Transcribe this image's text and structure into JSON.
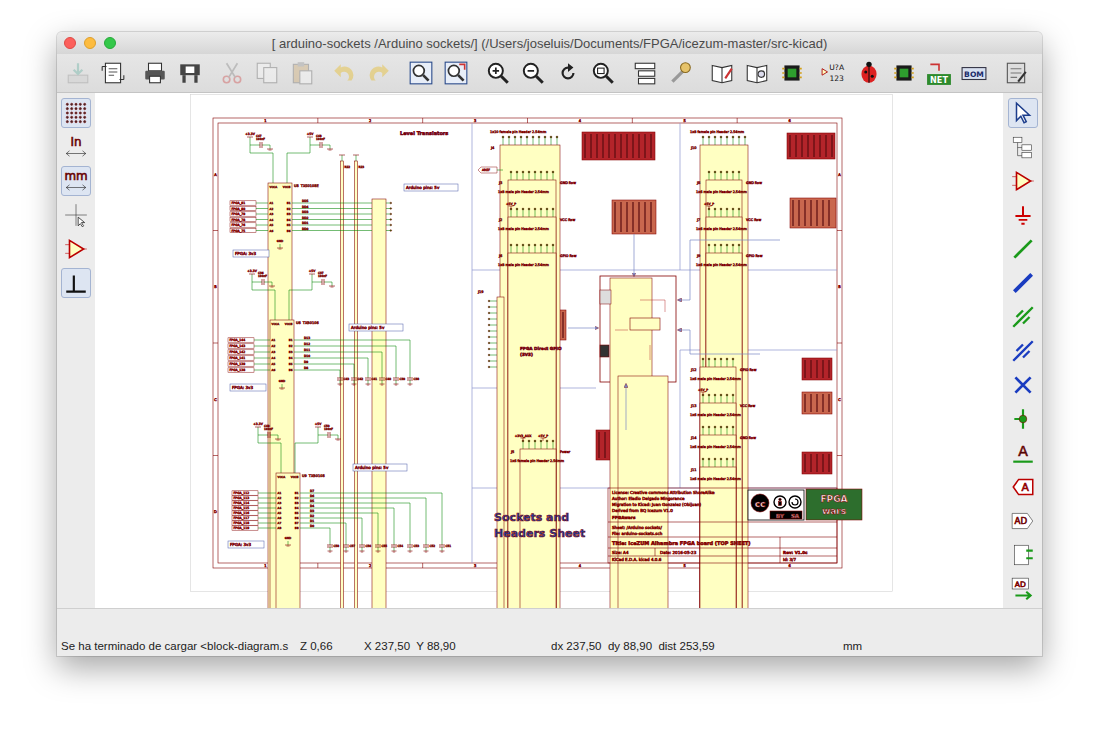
{
  "window": {
    "title": "[ arduino-sockets /Arduino sockets/] (/Users/joseluis/Documents/FPGA/icezum-master/src-kicad)"
  },
  "toolbar": {
    "groups": [
      [
        {
          "kind": "save",
          "disabled": true
        },
        {
          "kind": "page-settings",
          "disabled": false
        }
      ],
      [
        {
          "kind": "print",
          "disabled": false
        },
        {
          "kind": "plot",
          "disabled": false
        }
      ],
      [
        {
          "kind": "cut",
          "disabled": true
        },
        {
          "kind": "copy",
          "disabled": true
        },
        {
          "kind": "paste",
          "disabled": true
        }
      ],
      [
        {
          "kind": "undo",
          "disabled": true
        },
        {
          "kind": "redo",
          "disabled": true
        }
      ],
      [
        {
          "kind": "find",
          "disabled": false
        },
        {
          "kind": "find-replace",
          "disabled": false
        }
      ],
      [
        {
          "kind": "zoom-in",
          "disabled": false
        },
        {
          "kind": "zoom-out",
          "disabled": false
        },
        {
          "kind": "redraw",
          "disabled": false
        },
        {
          "kind": "zoom-fit",
          "disabled": false
        }
      ],
      [
        {
          "kind": "hierarchy",
          "disabled": false
        },
        {
          "kind": "leave-sheet",
          "disabled": false
        }
      ],
      [
        {
          "kind": "lib-editor",
          "disabled": false
        },
        {
          "kind": "lib-browser",
          "disabled": false
        },
        {
          "kind": "footprint",
          "disabled": false
        }
      ],
      [
        {
          "kind": "annotate",
          "label": "U?A",
          "sublabel": "123",
          "disabled": false
        },
        {
          "kind": "erc",
          "disabled": false
        },
        {
          "kind": "assign-fp",
          "disabled": false
        },
        {
          "kind": "netlist",
          "label": "NET",
          "disabled": false
        },
        {
          "kind": "bom",
          "label": "BOM",
          "disabled": false
        }
      ],
      [
        {
          "kind": "pcbnew",
          "disabled": false
        }
      ]
    ]
  },
  "left_toolbar": [
    {
      "kind": "grid",
      "selected": true
    },
    {
      "kind": "units-inch",
      "label": "In",
      "selected": false
    },
    {
      "kind": "units-mm",
      "label": "mm",
      "selected": true
    },
    {
      "kind": "cursor",
      "selected": false
    },
    {
      "kind": "hidden-pins",
      "selected": false
    },
    {
      "kind": "wire-angle",
      "selected": true
    }
  ],
  "right_toolbar": [
    {
      "kind": "select",
      "selected": true
    },
    {
      "kind": "hier-nav",
      "selected": false
    },
    {
      "kind": "component",
      "selected": false
    },
    {
      "kind": "power",
      "selected": false
    },
    {
      "kind": "wire",
      "selected": false
    },
    {
      "kind": "bus",
      "selected": false
    },
    {
      "kind": "wire-entry",
      "selected": false
    },
    {
      "kind": "bus-entry",
      "selected": false
    },
    {
      "kind": "no-connect",
      "selected": false
    },
    {
      "kind": "junction",
      "selected": false
    },
    {
      "kind": "net-label",
      "label": "A",
      "selected": false
    },
    {
      "kind": "global-label",
      "label": "A",
      "selected": false
    },
    {
      "kind": "hier-label",
      "label": "AD",
      "selected": false
    },
    {
      "kind": "hier-sheet",
      "selected": false
    },
    {
      "kind": "import-pin",
      "label": "AD",
      "selected": false
    }
  ],
  "schematic": {
    "frame": {
      "columns": [
        "1",
        "2",
        "3",
        "4",
        "5",
        "6"
      ],
      "rows": [
        "A",
        "B",
        "C",
        "D"
      ]
    },
    "section_title": "Level Translators",
    "translators": [
      {
        "ref": "U8",
        "part": "TXS0108E",
        "fpga_pins": [
          "FPGA_81",
          "FPGA_80",
          "FPGA_79",
          "FPGA_78",
          "FPGA_76",
          "FPGA_75"
        ],
        "a_pins": [
          "A1",
          "A2",
          "A3",
          "A4",
          "A5",
          "A6"
        ],
        "b_pins": [
          "B1",
          "B2",
          "B3",
          "B4",
          "B5",
          "B6"
        ],
        "nets": [
          "DD5",
          "DD4",
          "DD3",
          "DD2",
          "DD1",
          "DD0"
        ],
        "supply_pins": [
          "VCCA",
          "VCCB"
        ],
        "ground_pin": "GND",
        "caps": [
          {
            "ref": "C47",
            "value": "100nF"
          },
          {
            "ref": "C48",
            "value": "100nF"
          }
        ],
        "power": [
          "+3.3V",
          "+5V"
        ],
        "pullups": [
          "R22",
          "R23"
        ],
        "load_caps": [],
        "arduino_label": "Arduino pins: 5v",
        "fpga_label": "FPGA: 3v3"
      },
      {
        "ref": "U6",
        "part": "TXB0106",
        "fpga_pins": [
          "FPGA_144",
          "FPGA_143",
          "FPGA_142",
          "FPGA_141",
          "FPGA_139",
          "FPGA_138"
        ],
        "a_pins": [
          "A1",
          "A2",
          "A3",
          "A4",
          "A5",
          "A6"
        ],
        "b_pins": [
          "B1",
          "B2",
          "B3",
          "B4",
          "B5",
          "B6"
        ],
        "nets": [
          "D13",
          "D12",
          "D11",
          "D10",
          "D9",
          "D8"
        ],
        "supply_pins": [
          "VCCA",
          "VCCB"
        ],
        "ground_pin": "GND",
        "caps": [
          {
            "ref": "C36",
            "value": "100nF"
          },
          {
            "ref": "C37",
            "value": "100nF"
          }
        ],
        "power": [
          "+3.3V",
          "+5V"
        ],
        "pullups": [],
        "load_caps": [
          "C38",
          "C39",
          "C40",
          "C41",
          "C42",
          "C43"
        ],
        "arduino_label": "Arduino pins: 5v",
        "fpga_label": "FPGA: 3v3"
      },
      {
        "ref": "U9",
        "part": "TXB0108",
        "fpga_pins": [
          "FPGA_112",
          "FPGA_113",
          "FPGA_114",
          "FPGA_115",
          "FPGA_116",
          "FPGA_117",
          "FPGA_118",
          "FPGA_119"
        ],
        "a_pins": [
          "A1",
          "A2",
          "A3",
          "A4",
          "A5",
          "A6",
          "A7",
          "A8"
        ],
        "b_pins": [
          "B1",
          "B2",
          "B3",
          "B4",
          "B5",
          "B6",
          "B7",
          "B8"
        ],
        "nets": [
          "D7",
          "D6",
          "D5",
          "D4",
          "D3",
          "D2",
          "D1",
          "D0"
        ],
        "supply_pins": [
          "VCCA",
          "VCCB"
        ],
        "ground_pin": "GND",
        "caps": [
          {
            "ref": "C49",
            "value": "100nF"
          },
          {
            "ref": "C50",
            "value": "100nF"
          }
        ],
        "power": [
          "+3.3V",
          "+5V"
        ],
        "pullups": [],
        "load_caps": [
          "C51",
          "C52",
          "C53",
          "C54",
          "C55",
          "C56",
          "C57",
          "C58"
        ],
        "arduino_label": "Arduino pins: 5v",
        "fpga_label": "FPGA: 3v3"
      }
    ],
    "headers": [
      {
        "ref": "J4",
        "caption": "1x10 female pin Header 2.54mm",
        "row": "",
        "power": []
      },
      {
        "ref": "J3",
        "caption": "1x8 male pin Header 2.54mm",
        "row": "GND Row",
        "power": []
      },
      {
        "ref": "J2",
        "caption": "1x8 male pin Header 2.54mm",
        "row": "VCC Row",
        "power": [
          "+5V_P"
        ]
      },
      {
        "ref": "J6",
        "caption": "1x8 male pin Header 2.54mm",
        "row": "GPIO Row",
        "power": []
      },
      {
        "ref": "J10",
        "caption": "1x8 female pin Header 2.54mm",
        "row": "",
        "power": []
      },
      {
        "ref": "J8",
        "caption": "1x6 male pin Header 2.54mm",
        "row": "GND Row",
        "power": []
      },
      {
        "ref": "J7",
        "caption": "1x6 male pin Header 2.54mm",
        "row": "VCC Row",
        "power": [
          "+5V_P"
        ]
      },
      {
        "ref": "J9",
        "caption": "1x6 male pin Header 2.54mm",
        "row": "GPIO Row",
        "power": []
      },
      {
        "ref": "J12",
        "caption": "1x6 male pin Header 2.54mm",
        "row": "GPIO Row",
        "power": []
      },
      {
        "ref": "J13",
        "caption": "1x6 male pin Header 2.54mm",
        "row": "VCC Row",
        "power": [
          "+5V_P"
        ]
      },
      {
        "ref": "J14",
        "caption": "1x6 male pin Header 2.54mm",
        "row": "GND Row",
        "power": []
      },
      {
        "ref": "J11",
        "caption": "1x6 male pin Header 2.54mm",
        "row": "",
        "power": []
      },
      {
        "ref": "J5",
        "caption": "1x6 female pin Header 2.54mm",
        "row": "Power",
        "power": [
          "+3V3_AUX",
          "+5V_P"
        ]
      }
    ],
    "aref": "AREF",
    "gpio": {
      "ref": "J19",
      "caption": [
        "FPGA Direct GPIO",
        "(3V3)"
      ]
    },
    "sheet_title": [
      "Sockets and",
      "Headers Sheet"
    ],
    "title_block": {
      "notes": [
        "License: Creative commons Attribution ShareAlike",
        "Author: Eladio Delgado Mingorance",
        "Migration to Kicad: Juan Gonzalez (Obijuan)",
        "Derived from BQ Icezum V1.0"
      ],
      "company": "FPGAwars",
      "sheet": "Sheet: /Arduino sockets/",
      "file": "File: arduino-sockets.sch",
      "title": "Title: IceZUM Alhambra FPGA board (TOP SHEET)",
      "size": "Size: A4",
      "date": "Date: 2016-05-23",
      "rev": "Rev: V1.0c",
      "tool": "KiCad E.D.A.  kicad 4.0.6",
      "id": "Id: 3/7"
    },
    "cc_logo": {
      "mark": "cc",
      "terms": [
        "BY",
        "SA"
      ]
    },
    "org_logo": [
      "FPGA",
      "wars"
    ]
  },
  "status_bar": {
    "message": "Se ha terminado de cargar <block-diagram.s",
    "zoom": "Z 0,66",
    "position": "X 237,50  Y 88,90",
    "delta": "dx 237,50  dy 88,90  dist 253,59",
    "units": "mm"
  }
}
